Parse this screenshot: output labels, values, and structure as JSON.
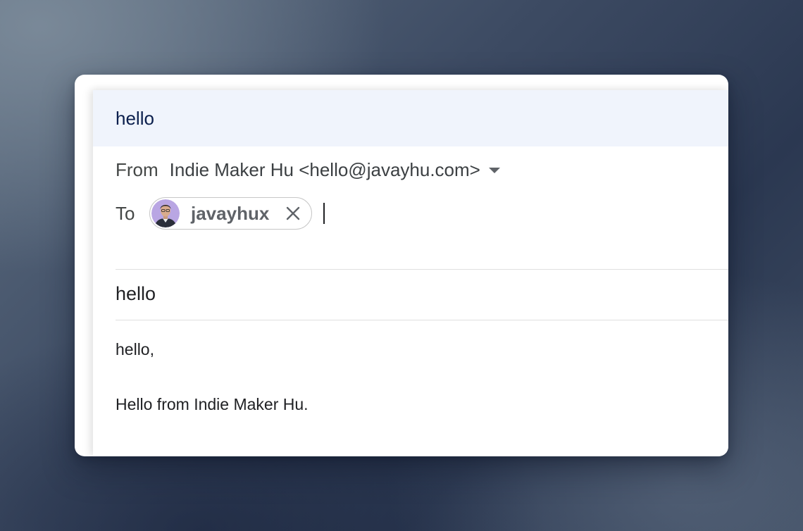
{
  "compose": {
    "title": "hello",
    "from_label": "From",
    "from_value": "Indie Maker Hu <hello@javayhu.com>",
    "to_label": "To",
    "recipient": {
      "name": "javayhux",
      "avatar_icon": "user-avatar"
    },
    "subject": "hello",
    "body": {
      "line1": "hello,",
      "line2": "Hello from Indie Maker Hu."
    }
  },
  "colors": {
    "title_bar_bg": "#f0f4fc",
    "title_text": "#0b1f4d",
    "chip_border": "#c7c7c7"
  }
}
